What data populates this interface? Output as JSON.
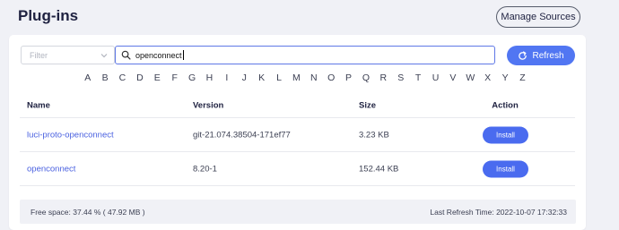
{
  "header": {
    "title": "Plug-ins",
    "manage_sources_label": "Manage Sources"
  },
  "toolbar": {
    "filter_placeholder": "Filter",
    "search_value": "openconnect",
    "refresh_label": "Refresh"
  },
  "alphabet": [
    "A",
    "B",
    "C",
    "D",
    "E",
    "F",
    "G",
    "H",
    "I",
    "J",
    "K",
    "L",
    "M",
    "N",
    "O",
    "P",
    "Q",
    "R",
    "S",
    "T",
    "U",
    "V",
    "W",
    "X",
    "Y",
    "Z"
  ],
  "table": {
    "columns": {
      "name": "Name",
      "version": "Version",
      "size": "Size",
      "action": "Action"
    },
    "rows": [
      {
        "name": "luci-proto-openconnect",
        "version": "git-21.074.38504-171ef77",
        "size": "3.23 KB",
        "action": "Install"
      },
      {
        "name": "openconnect",
        "version": "8.20-1",
        "size": "152.44 KB",
        "action": "Install"
      }
    ]
  },
  "footer": {
    "free_space": "Free space: 37.44 % ( 47.92 MB )",
    "last_refresh": "Last Refresh Time: 2022-10-07 17:32:33"
  },
  "colors": {
    "accent": "#5176f2",
    "link": "#4a61e0",
    "background": "#f0f1f6"
  }
}
